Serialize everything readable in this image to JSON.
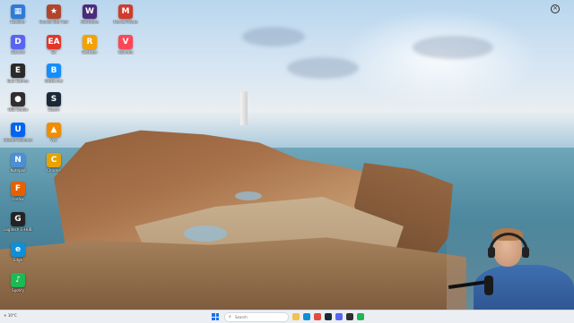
{
  "desktop_icons": [
    {
      "label": "Explorer",
      "color": "#2f7bd8",
      "glyph": "▦"
    },
    {
      "label": "Honkai Star Rail",
      "color": "#b2442b",
      "glyph": "★"
    },
    {
      "label": "Warframe",
      "color": "#4a2a7a",
      "glyph": "W"
    },
    {
      "label": "Marvel Rivals",
      "color": "#d13b2a",
      "glyph": "M"
    },
    {
      "label": "Discord",
      "color": "#5865f2",
      "glyph": "D"
    },
    {
      "label": "Battle.net",
      "color": "#148eff",
      "glyph": "B"
    },
    {
      "label": "Rockstar",
      "color": "#f3a200",
      "glyph": "R"
    },
    {
      "label": "Valorant",
      "color": "#ff4655",
      "glyph": "V"
    },
    {
      "label": "Epic Games",
      "color": "#2a2a2a",
      "glyph": "E"
    },
    {
      "label": "Steam",
      "color": "#1b2838",
      "glyph": "S"
    },
    {
      "label": "Ubisoft Connect",
      "color": "#0064f0",
      "glyph": "U"
    },
    {
      "label": "EA",
      "color": "#e2362b",
      "glyph": "EA"
    },
    {
      "label": "OBS Studio",
      "color": "#302e31",
      "glyph": "●"
    },
    {
      "label": "Spotify",
      "color": "#1db954",
      "glyph": "♪"
    },
    {
      "label": "Chrome",
      "color": "#e8a300",
      "glyph": "C"
    },
    {
      "label": "Firefox",
      "color": "#e66000",
      "glyph": "F"
    },
    {
      "label": "VLC",
      "color": "#f28c00",
      "glyph": "▲"
    },
    {
      "label": "Notepad",
      "color": "#4d8fd6",
      "glyph": "N"
    },
    {
      "label": "Edge",
      "color": "#0f8fd6",
      "glyph": "e"
    },
    {
      "label": "Logitech G HUB",
      "color": "#232323",
      "glyph": "G"
    }
  ],
  "taskbar": {
    "weather": "10°C",
    "search_placeholder": "Search"
  },
  "overlay": {
    "close_label": ""
  }
}
